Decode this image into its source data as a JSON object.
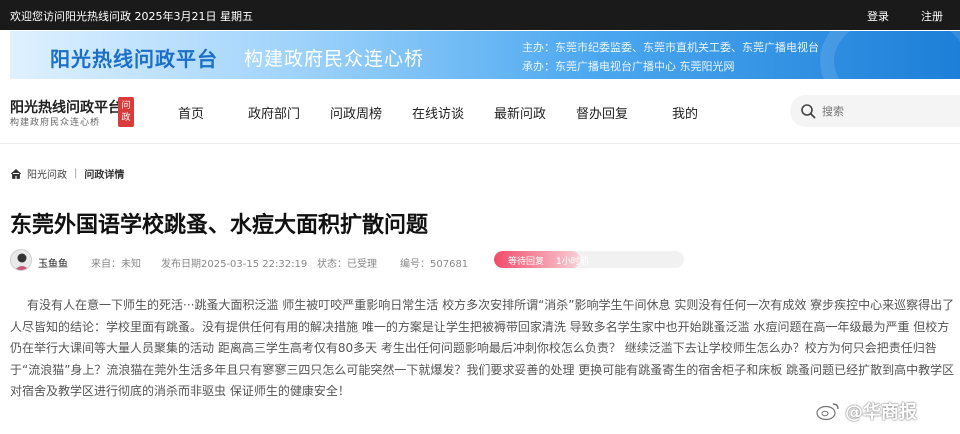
{
  "topbar": {
    "welcome": "欢迎您访问阳光热线问政  2025年3月21日 星期五",
    "login": "登录",
    "register": "注册"
  },
  "banner": {
    "title": "阳光热线问政平台",
    "slogan": "构建政府民众连心桥",
    "host": "主办：东莞市纪委监委、东莞市直机关工委、东莞广播电视台",
    "organizer": "承办：东莞广播电视台广播中心  东莞阳光网"
  },
  "logo": {
    "title": "阳光热线问政平台",
    "subtitle": "构建政府民众连心桥",
    "badge": "问政"
  },
  "nav": {
    "items": [
      "首页",
      "政府部门",
      "问政周榜",
      "在线访谈",
      "最新问政",
      "督办回复",
      "我的"
    ]
  },
  "search": {
    "placeholder": "搜索",
    "icon": "search-icon"
  },
  "breadcrumb": {
    "home": "阳光问政",
    "current": "问政详情"
  },
  "article": {
    "title": "东莞外国语学校跳蚤、水痘大面积扩散问题",
    "author": "玉鱼鱼",
    "source": "来自：未知",
    "published": "发布日期2025-03-15 22:32:19",
    "status": "状态：已受理",
    "number": "编号：507681",
    "progress": {
      "label": "等待回复",
      "percent_text": "1小时前",
      "fraction": 0.45,
      "color": "#f24b6a"
    },
    "body": "有没有人在意一下师生的死活···跳蚤大面积泛滥 师生被叮咬严重影响日常生活 校方多次安排所谓“消杀”影响学生午间休息 实则没有任何一次有成效 寮步疾控中心来巡察得出了人尽皆知的结论：学校里面有跳蚤。没有提供任何有用的解决措施 唯一的方案是让学生把被褥带回家清洗 导致多名学生家中也开始跳蚤泛滥 水痘问题在高一年级最为严重 但校方仍在举行大课间等大量人员聚集的活动 距离高三学生高考仅有80多天 考生出任何问题影响最后冲刺你校怎么负责？ 继续泛滥下去让学校师生怎么办？校方为何只会把责任归咎于“流浪猫”身上？流浪猫在莞外生活多年且只有寥寥三四只怎么可能突然一下就爆发？我们要求妥善的处理 更换可能有跳蚤寄生的宿舍柜子和床板 跳蚤问题已经扩散到高中教学区 对宿舍及教学区进行彻底的消杀而非驱虫 保证师生的健康安全！"
  },
  "watermark": {
    "text": "@华商报"
  }
}
